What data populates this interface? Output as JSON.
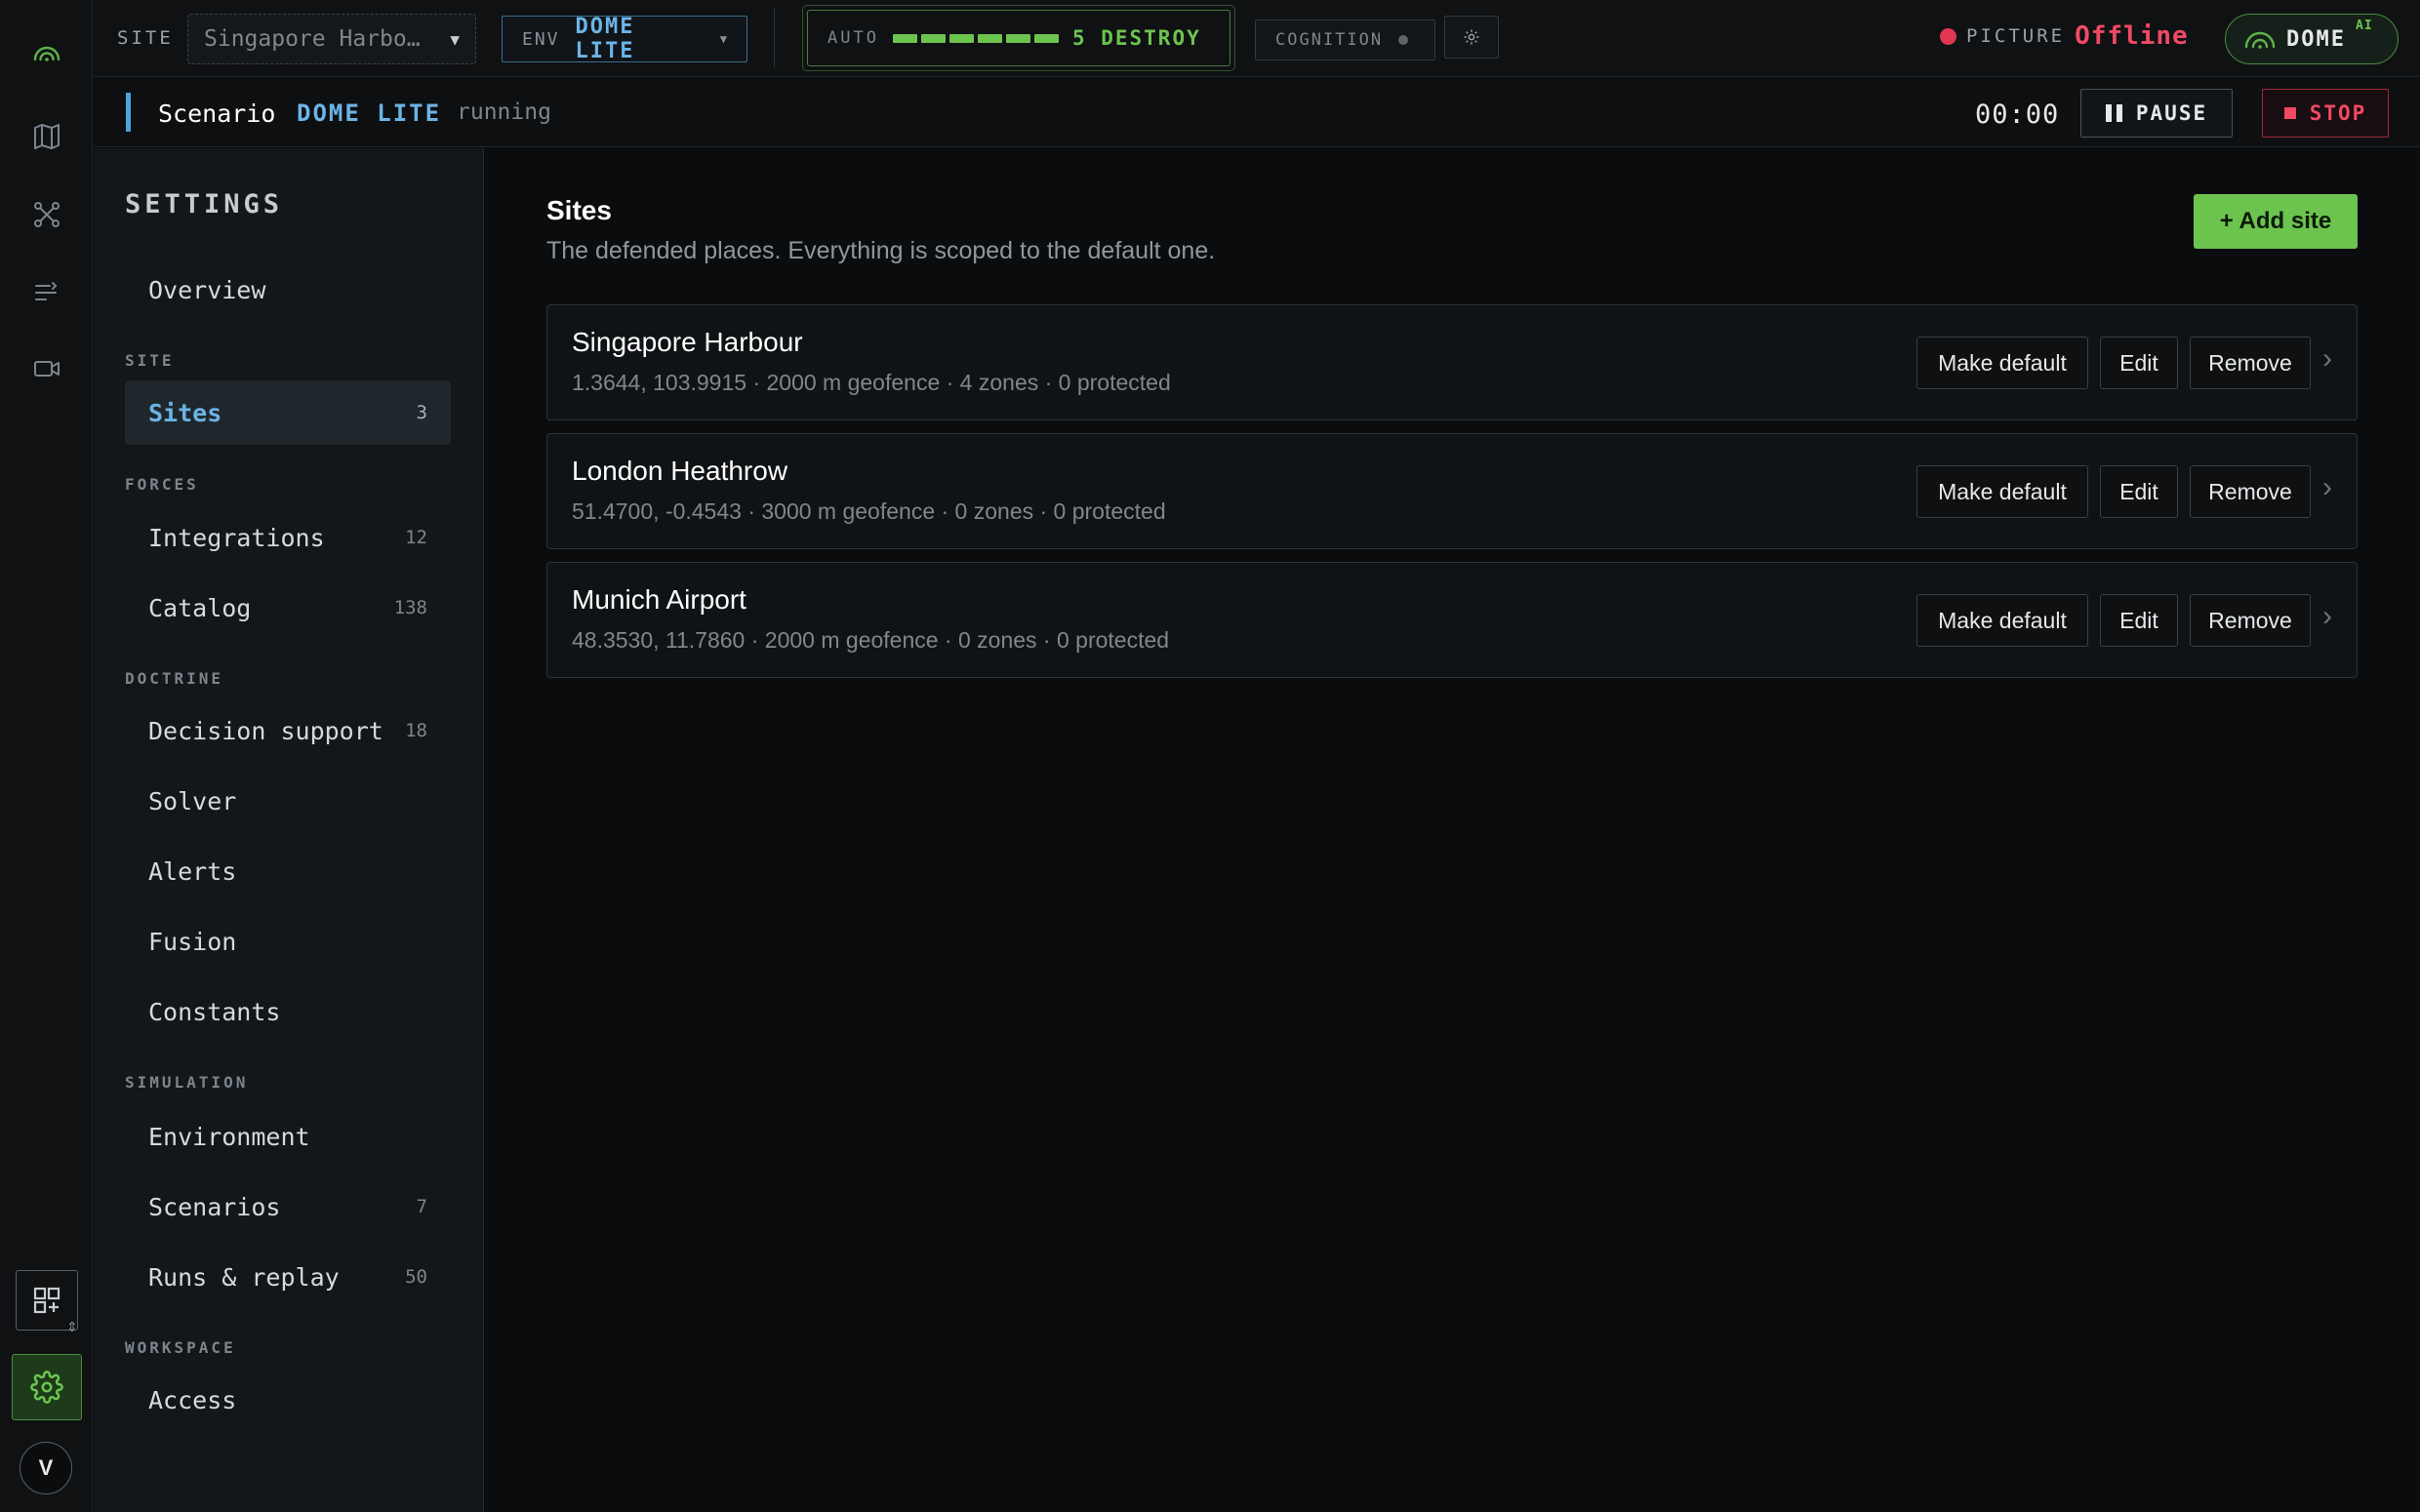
{
  "rail": {
    "icons": [
      "dome-logo-icon",
      "map-icon",
      "nodes-icon",
      "list-filter-icon",
      "camera-icon",
      "widgets-icon",
      "settings-gear-icon"
    ],
    "avatar_initial": "V"
  },
  "topbar": {
    "site_label": "SITE",
    "site_value": "Singapore Harbo…",
    "env_label": "ENV",
    "env_value": "DOME LITE",
    "auto_label": "AUTO",
    "auto_level": 5,
    "auto_value": "5 DESTROY",
    "cognition_label": "COGNITION",
    "picture_label": "PICTURE",
    "picture_status": "Offline",
    "brand": "DOME",
    "brand_sup": "AI"
  },
  "scenario": {
    "label": "Scenario",
    "name": "DOME LITE",
    "status": "running",
    "time": "00:00",
    "pause_label": "PAUSE",
    "stop_label": "STOP"
  },
  "settings": {
    "title": "SETTINGS",
    "overview": "Overview",
    "groups": {
      "site": "SITE",
      "forces": "FORCES",
      "doctrine": "DOCTRINE",
      "simulation": "SIMULATION",
      "workspace": "WORKSPACE"
    },
    "items": {
      "sites": {
        "label": "Sites",
        "count": "3"
      },
      "integrations": {
        "label": "Integrations",
        "count": "12"
      },
      "catalog": {
        "label": "Catalog",
        "count": "138"
      },
      "decision_support": {
        "label": "Decision support",
        "count": "18"
      },
      "solver": {
        "label": "Solver"
      },
      "alerts": {
        "label": "Alerts"
      },
      "fusion": {
        "label": "Fusion"
      },
      "constants": {
        "label": "Constants"
      },
      "environment": {
        "label": "Environment"
      },
      "scenarios": {
        "label": "Scenarios",
        "count": "7"
      },
      "runs_replay": {
        "label": "Runs & replay",
        "count": "50"
      },
      "access": {
        "label": "Access"
      }
    }
  },
  "main": {
    "title": "Sites",
    "subtitle": "The defended places. Everything is scoped to the default one.",
    "add_label": "+ Add site",
    "make_default_label": "Make default",
    "edit_label": "Edit",
    "remove_label": "Remove",
    "sites": [
      {
        "name": "Singapore Harbour",
        "meta": "1.3644, 103.9915 · 2000 m geofence · 4 zones · 0 protected"
      },
      {
        "name": "London Heathrow",
        "meta": "51.4700, -0.4543 · 3000 m geofence · 0 zones · 0 protected"
      },
      {
        "name": "Munich Airport",
        "meta": "48.3530, 11.7860 · 2000 m geofence · 0 zones · 0 protected"
      }
    ]
  },
  "colors": {
    "accent_green": "#6cc44f",
    "accent_blue": "#6cb4e6",
    "alert_red": "#f04a63",
    "background": "#0b0c0d"
  }
}
